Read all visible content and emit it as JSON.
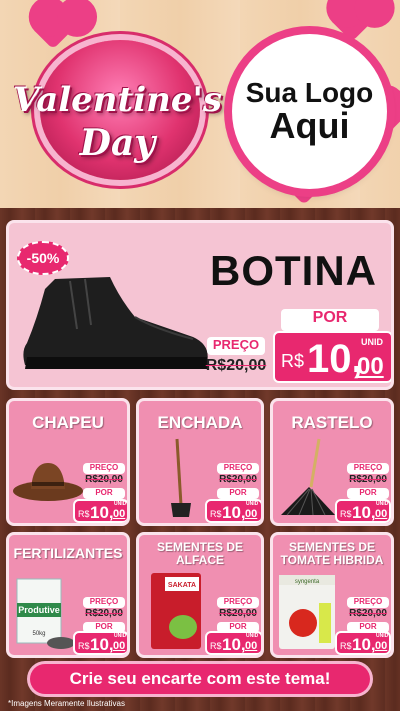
{
  "header": {
    "valentines_line1": "Valentine's",
    "valentines_line2": "Day",
    "logo_line1": "Sua Logo",
    "logo_line2": "Aqui"
  },
  "featured": {
    "discount": "-50%",
    "title": "BOTINA",
    "preco_label": "PREÇO",
    "old_price": "R$20,00",
    "por_label": "POR",
    "currency": "R$",
    "price_int": "10,",
    "price_dec": "00",
    "unid": "UNID"
  },
  "products": [
    {
      "title": "CHAPEU",
      "preco_label": "PREÇO",
      "old_price": "R$20,00",
      "por_label": "POR",
      "currency": "R$",
      "price_int": "10,",
      "price_dec": "00",
      "unid": "UNID"
    },
    {
      "title": "ENCHADA",
      "preco_label": "PREÇO",
      "old_price": "R$20,00",
      "por_label": "POR",
      "currency": "R$",
      "price_int": "10,",
      "price_dec": "00",
      "unid": "UNID"
    },
    {
      "title": "RASTELO",
      "preco_label": "PREÇO",
      "old_price": "R$20,00",
      "por_label": "POR",
      "currency": "R$",
      "price_int": "10,",
      "price_dec": "00",
      "unid": "UNID"
    },
    {
      "title": "FERTILIZANTES",
      "preco_label": "PREÇO",
      "old_price": "R$20,00",
      "por_label": "POR",
      "currency": "R$",
      "price_int": "10,",
      "price_dec": "00",
      "unid": "UNID"
    },
    {
      "title": "SEMENTES DE ALFACE",
      "preco_label": "PREÇO",
      "old_price": "R$20,00",
      "por_label": "POR",
      "currency": "R$",
      "price_int": "10,",
      "price_dec": "00",
      "unid": "UNID"
    },
    {
      "title": "SEMENTES DE TOMATE HIBRIDA",
      "preco_label": "PREÇO",
      "old_price": "R$20,00",
      "por_label": "POR",
      "currency": "R$",
      "price_int": "10,",
      "price_dec": "00",
      "unid": "UNID"
    }
  ],
  "product_labels": {
    "fertilizer_brand": "Produtive",
    "fertilizer_weight": "50kg",
    "seed_brand": "SAKATA",
    "tomato_brand": "syngenta"
  },
  "cta": "Crie seu encarte com este tema!",
  "footer_note": "*Imagens Meramente Ilustrativas",
  "colors": {
    "accent": "#e8286f",
    "card": "#f08fb1",
    "wood": "#5b2b1f"
  }
}
